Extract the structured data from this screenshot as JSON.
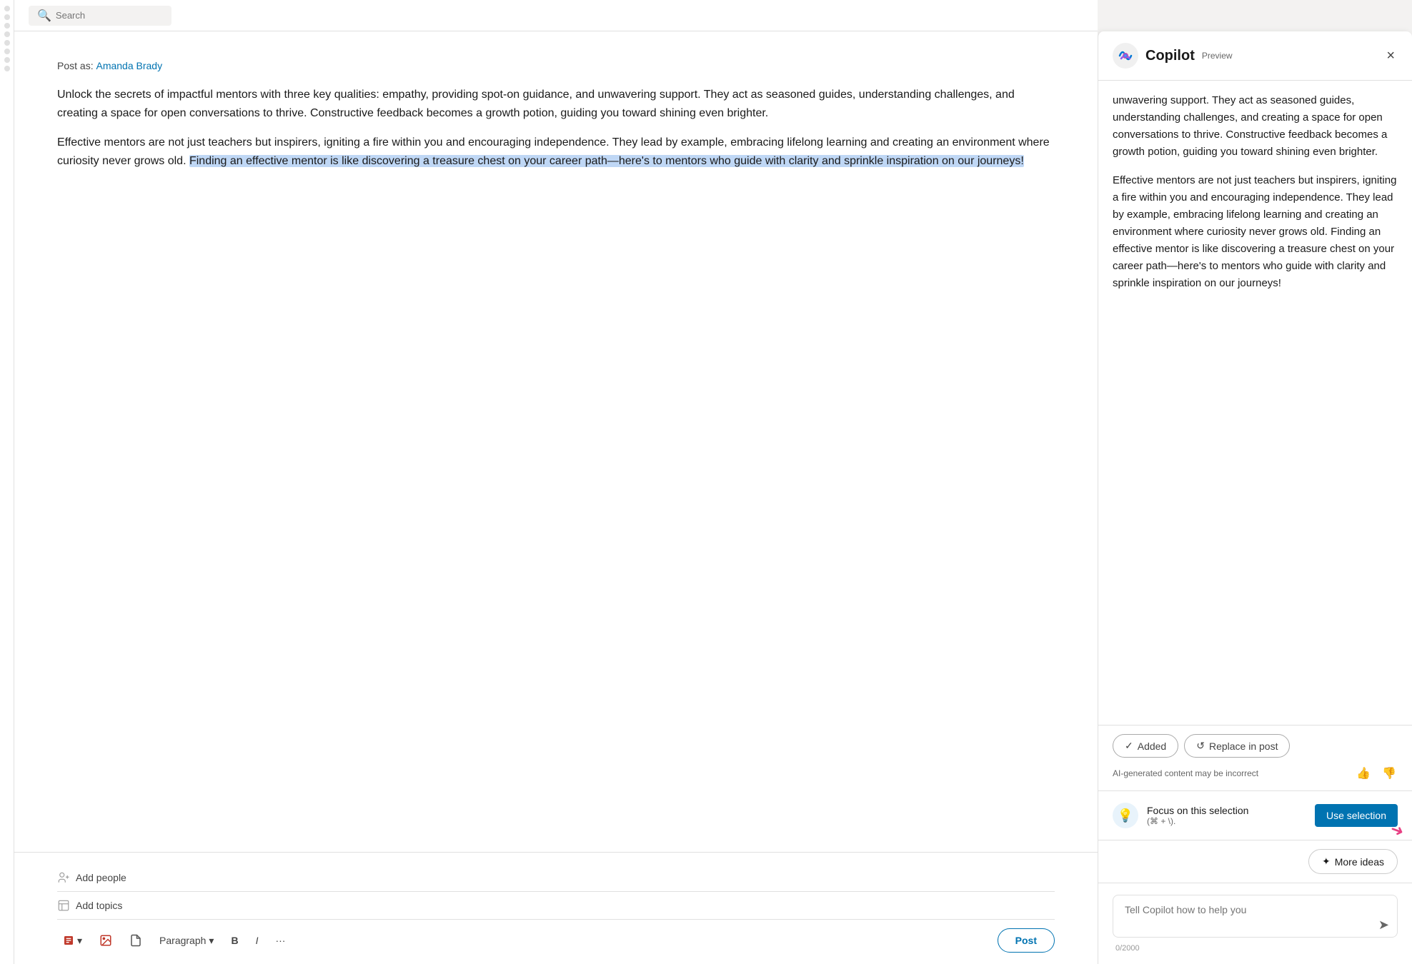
{
  "topbar": {
    "search_placeholder": "Search"
  },
  "post": {
    "post_as_label": "Post as:",
    "author_name": "Amanda Brady",
    "paragraph1": "Unlock the secrets of impactful mentors with three key qualities: empathy, providing spot-on guidance, and unwavering support. They act as seasoned guides, understanding challenges, and creating a space for open conversations to thrive. Constructive feedback becomes a growth potion, guiding you toward shining even brighter.",
    "paragraph2_start": "Effective mentors are not just teachers but inspirers, igniting a fire within you and encouraging independence. They lead by example, embracing lifelong learning and creating an environment where curiosity never grows old. ",
    "paragraph2_highlighted": "Finding an effective mentor is like discovering a treasure chest on your career path—here's to mentors who guide with clarity and sprinkle inspiration on our journeys!",
    "add_people_label": "Add people",
    "add_topics_label": "Add topics",
    "format_paragraph_label": "Paragraph",
    "format_bold_label": "B",
    "format_italic_label": "I",
    "format_more_label": "···",
    "post_button_label": "Post"
  },
  "copilot": {
    "title": "Copilot",
    "preview_badge": "Preview",
    "close_label": "×",
    "scrolled_text_1": "unwavering support. They act as seasoned guides, understanding challenges, and creating a space for open conversations to thrive. Constructive feedback becomes a growth potion, guiding you toward shining even brighter.",
    "scrolled_text_2": "Effective mentors are not just teachers but inspirers, igniting a fire within you and encouraging independence. They lead by example, embracing lifelong learning and creating an environment where curiosity never grows old. Finding an effective mentor is like discovering a treasure chest on your career path—here's to mentors who guide with clarity and sprinkle inspiration on our journeys!",
    "added_button_label": "Added",
    "replace_in_post_label": "Replace in post",
    "ai_disclaimer": "AI-generated content may be incorrect",
    "thumbup_label": "👍",
    "thumbdown_label": "👎",
    "focus_title": "Focus on this selection",
    "focus_shortcut": "(⌘ + \\).",
    "use_selection_button_label": "Use selection",
    "more_ideas_label": "More ideas",
    "tell_copilot_placeholder": "Tell Copilot how to help you",
    "char_count": "0/2000",
    "send_label": "➤"
  }
}
